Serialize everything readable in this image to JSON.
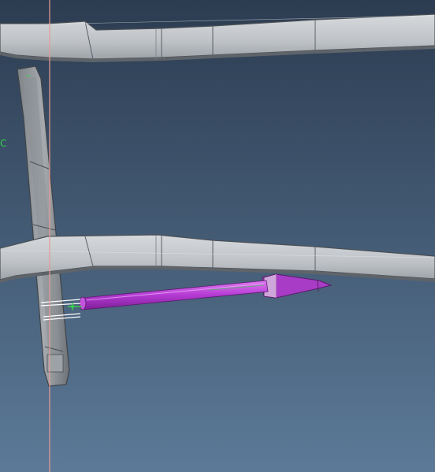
{
  "viewport": {
    "background_top": "#2c3c51",
    "background_bottom": "#5c7a98"
  },
  "colors": {
    "structure_fill": "#c2c6ca",
    "structure_edge": "#4a4f55",
    "structure_shadow": "#5e646a",
    "rod_fill": "#b43ad3",
    "rod_highlight": "#e07af2",
    "bracket_fill": "#a93cc6",
    "datum_line": "#e89a95",
    "marker_green": "#35d04a",
    "bolt_white": "#ffffff"
  },
  "labels": {
    "edge_mark": "C"
  }
}
